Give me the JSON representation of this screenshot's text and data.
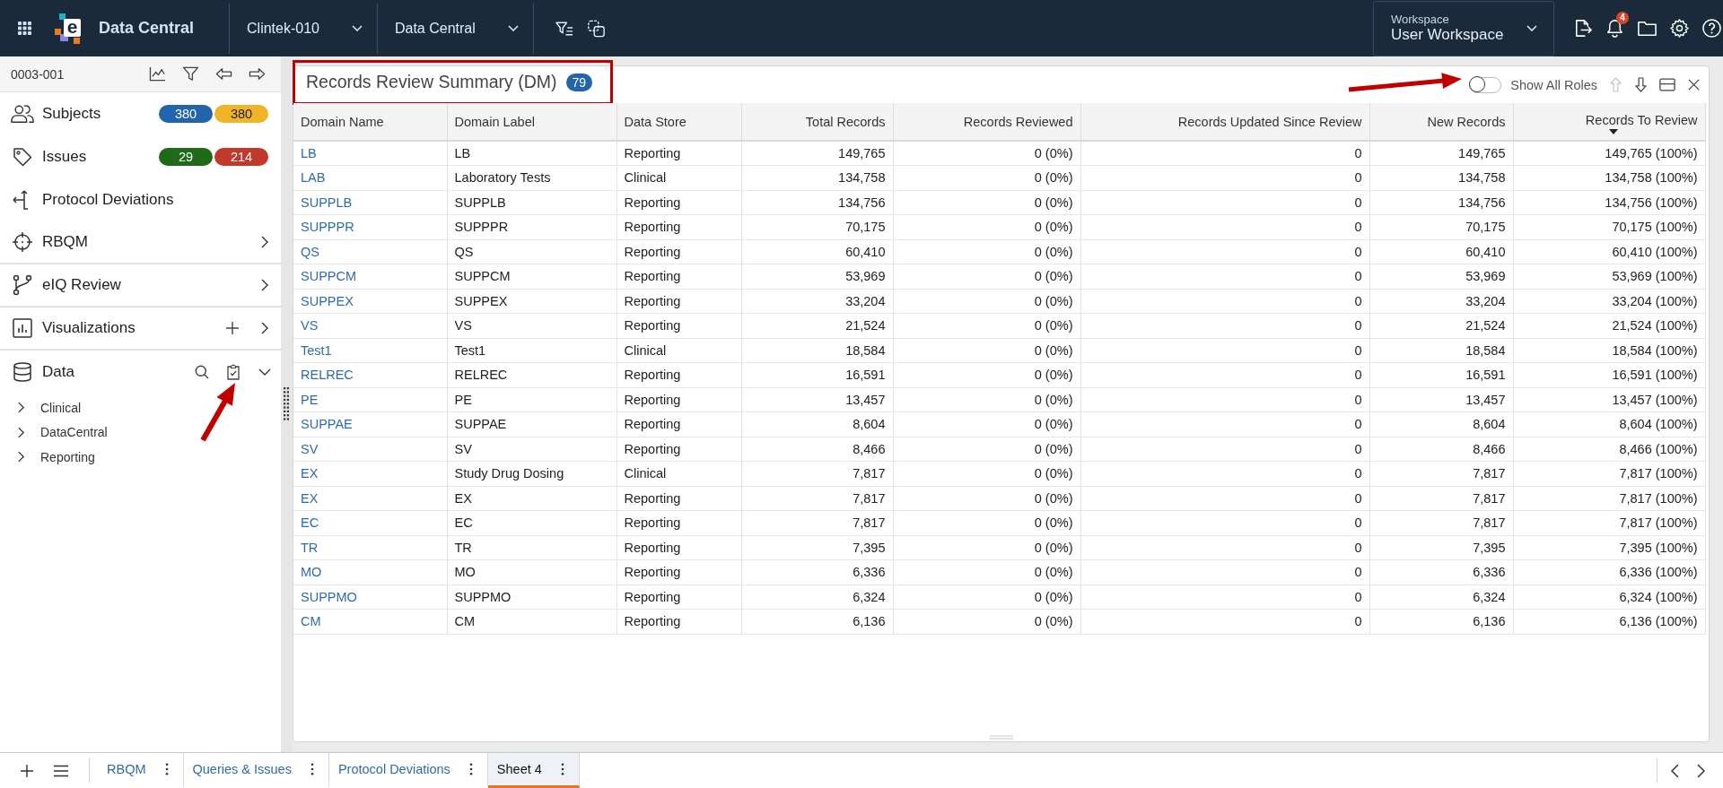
{
  "header": {
    "logo_letter": "e",
    "app_name": "Data Central",
    "selectors": [
      {
        "value": "Clintek-010"
      },
      {
        "value": "Data Central"
      }
    ],
    "workspace": {
      "label": "Workspace",
      "value": "User Workspace"
    },
    "notification_count": "4"
  },
  "sidebar": {
    "subject_id": "0003-001",
    "items": [
      {
        "kind": "counts",
        "label": "Subjects",
        "badges": [
          {
            "text": "380",
            "color": "#2166ad"
          },
          {
            "text": "380",
            "color": "#f0b429"
          }
        ]
      },
      {
        "kind": "counts",
        "label": "Issues",
        "badges": [
          {
            "text": "29",
            "color": "#1f6b1a"
          },
          {
            "text": "214",
            "color": "#c0392b"
          }
        ]
      },
      {
        "kind": "link",
        "label": "Protocol Deviations"
      },
      {
        "kind": "section",
        "label": "RBQM",
        "expanded": false
      },
      {
        "kind": "section",
        "label": "eIQ Review",
        "expanded": false
      },
      {
        "kind": "section",
        "label": "Visualizations",
        "expanded": false,
        "tools": [
          {
            "kind": "add",
            "pointed_at": false
          }
        ]
      },
      {
        "kind": "section",
        "label": "Data",
        "expanded": true,
        "tools": [
          {
            "kind": "search",
            "pointed_at": false
          },
          {
            "kind": "clipboard",
            "pointed_at": true
          }
        ],
        "children": [
          {
            "label": "Clinical",
            "expanded": false
          },
          {
            "label": "DataCentral",
            "expanded": false
          },
          {
            "label": "Reporting",
            "expanded": false
          }
        ]
      }
    ]
  },
  "panel": {
    "title": "Records Review Summary (DM)",
    "count": "79",
    "highlighted": true,
    "toggle": {
      "label": "Show All Roles",
      "on": false,
      "pointed_at": true
    },
    "actions": [
      {
        "kind": "move-up",
        "disabled": true
      },
      {
        "kind": "move-down",
        "disabled": false
      },
      {
        "kind": "layout",
        "disabled": false
      },
      {
        "kind": "close",
        "disabled": false
      }
    ],
    "table": {
      "columns": [
        {
          "label": "Domain Name",
          "kind": "link",
          "sorted": false
        },
        {
          "label": "Domain Label",
          "kind": "text",
          "sorted": false
        },
        {
          "label": "Data Store",
          "kind": "text",
          "sorted": false
        },
        {
          "label": "Total Records",
          "kind": "number",
          "sorted": false
        },
        {
          "label": "Records Reviewed",
          "kind": "number",
          "sorted": false
        },
        {
          "label": "Records Updated Since Review",
          "kind": "number",
          "sorted": false
        },
        {
          "label": "New Records",
          "kind": "number",
          "sorted": false
        },
        {
          "label": "Records To Review",
          "kind": "number",
          "sorted": true
        }
      ],
      "rows": [
        [
          "LB",
          "LB",
          "Reporting",
          "149,765",
          "0 (0%)",
          "0",
          "149,765",
          "149,765 (100%)"
        ],
        [
          "LAB",
          "Laboratory Tests",
          "Clinical",
          "134,758",
          "0 (0%)",
          "0",
          "134,758",
          "134,758 (100%)"
        ],
        [
          "SUPPLB",
          "SUPPLB",
          "Reporting",
          "134,756",
          "0 (0%)",
          "0",
          "134,756",
          "134,756 (100%)"
        ],
        [
          "SUPPPR",
          "SUPPPR",
          "Reporting",
          "70,175",
          "0 (0%)",
          "0",
          "70,175",
          "70,175 (100%)"
        ],
        [
          "QS",
          "QS",
          "Reporting",
          "60,410",
          "0 (0%)",
          "0",
          "60,410",
          "60,410 (100%)"
        ],
        [
          "SUPPCM",
          "SUPPCM",
          "Reporting",
          "53,969",
          "0 (0%)",
          "0",
          "53,969",
          "53,969 (100%)"
        ],
        [
          "SUPPEX",
          "SUPPEX",
          "Reporting",
          "33,204",
          "0 (0%)",
          "0",
          "33,204",
          "33,204 (100%)"
        ],
        [
          "VS",
          "VS",
          "Reporting",
          "21,524",
          "0 (0%)",
          "0",
          "21,524",
          "21,524 (100%)"
        ],
        [
          "Test1",
          "Test1",
          "Clinical",
          "18,584",
          "0 (0%)",
          "0",
          "18,584",
          "18,584 (100%)"
        ],
        [
          "RELREC",
          "RELREC",
          "Reporting",
          "16,591",
          "0 (0%)",
          "0",
          "16,591",
          "16,591 (100%)"
        ],
        [
          "PE",
          "PE",
          "Reporting",
          "13,457",
          "0 (0%)",
          "0",
          "13,457",
          "13,457 (100%)"
        ],
        [
          "SUPPAE",
          "SUPPAE",
          "Reporting",
          "8,604",
          "0 (0%)",
          "0",
          "8,604",
          "8,604 (100%)"
        ],
        [
          "SV",
          "SV",
          "Reporting",
          "8,466",
          "0 (0%)",
          "0",
          "8,466",
          "8,466 (100%)"
        ],
        [
          "EX",
          "Study Drug Dosing",
          "Clinical",
          "7,817",
          "0 (0%)",
          "0",
          "7,817",
          "7,817 (100%)"
        ],
        [
          "EX",
          "EX",
          "Reporting",
          "7,817",
          "0 (0%)",
          "0",
          "7,817",
          "7,817 (100%)"
        ],
        [
          "EC",
          "EC",
          "Reporting",
          "7,817",
          "0 (0%)",
          "0",
          "7,817",
          "7,817 (100%)"
        ],
        [
          "TR",
          "TR",
          "Reporting",
          "7,395",
          "0 (0%)",
          "0",
          "7,395",
          "7,395 (100%)"
        ],
        [
          "MO",
          "MO",
          "Reporting",
          "6,336",
          "0 (0%)",
          "0",
          "6,336",
          "6,336 (100%)"
        ],
        [
          "SUPPMO",
          "SUPPMO",
          "Reporting",
          "6,324",
          "0 (0%)",
          "0",
          "6,324",
          "6,324 (100%)"
        ],
        [
          "CM",
          "CM",
          "Reporting",
          "6,136",
          "0 (0%)",
          "0",
          "6,136",
          "6,136 (100%)"
        ]
      ]
    }
  },
  "sheet_tabs": [
    {
      "label": "RBQM",
      "selected": false
    },
    {
      "label": "Queries & Issues",
      "selected": false
    },
    {
      "label": "Protocol Deviations",
      "selected": false
    },
    {
      "label": "Sheet 4",
      "selected": true
    }
  ]
}
